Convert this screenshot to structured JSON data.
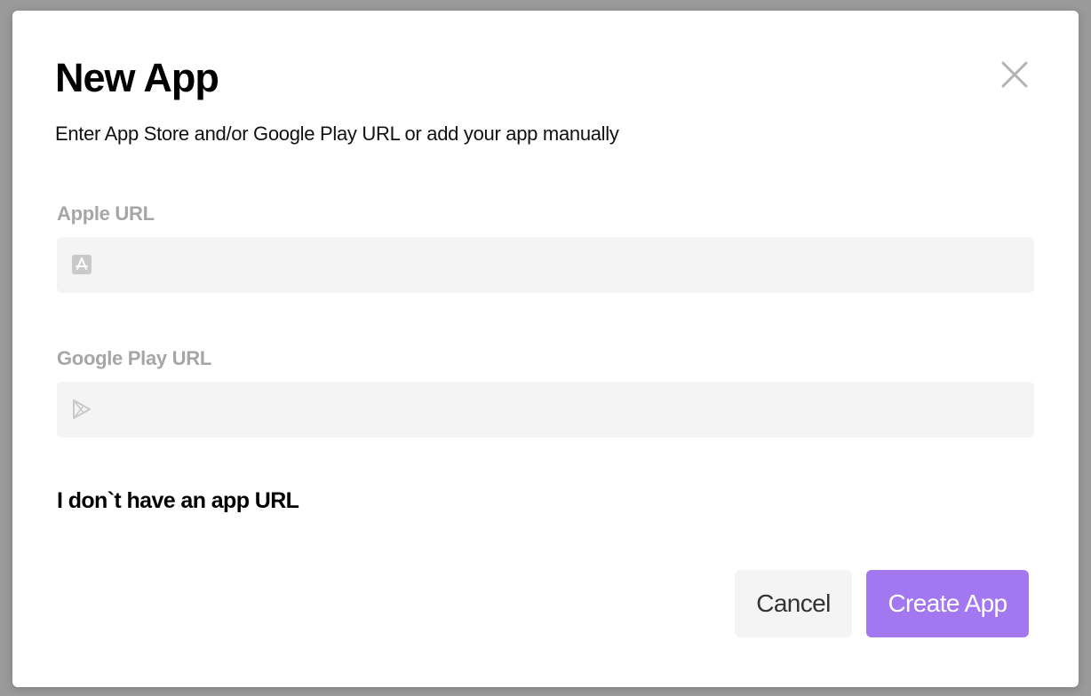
{
  "modal": {
    "title": "New App",
    "subtitle": "Enter App Store and/or Google Play URL or add your app manually",
    "close_icon": "close-icon"
  },
  "fields": {
    "apple": {
      "label": "Apple URL",
      "value": "",
      "placeholder": "",
      "icon": "app-store-icon"
    },
    "google": {
      "label": "Google Play URL",
      "value": "",
      "placeholder": "",
      "icon": "google-play-icon"
    }
  },
  "no_url_link": "I don`t have an app URL",
  "buttons": {
    "cancel": "Cancel",
    "create": "Create App"
  },
  "colors": {
    "accent": "#a277f0",
    "field_bg": "#f3f4f3",
    "label_muted": "#a6a6a6"
  }
}
